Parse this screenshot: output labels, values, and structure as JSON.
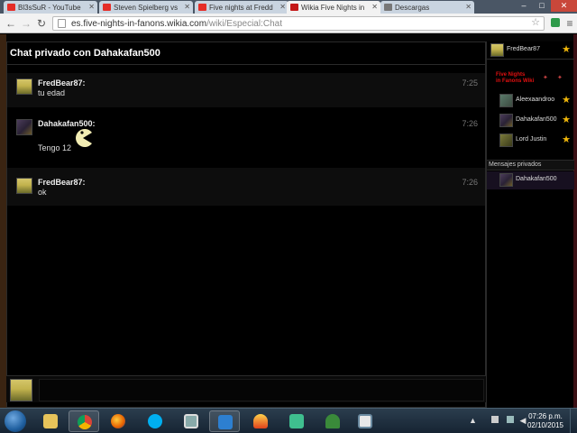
{
  "tabs": [
    {
      "label": "Bl3sSuR - YouTube",
      "favicon_color": "#e52d27"
    },
    {
      "label": "Steven Spielberg vs",
      "favicon_color": "#e52d27"
    },
    {
      "label": "Five nights at Fredd",
      "favicon_color": "#e52d27"
    },
    {
      "label": "Wikia Five Nights in",
      "favicon_color": "#c41818"
    },
    {
      "label": "Descargas",
      "favicon_color": "#777777"
    }
  ],
  "window_controls": {
    "minimize": "–",
    "maximize": "□",
    "close": "✕"
  },
  "toolbar": {
    "url_host": "es.five-nights-in-fanons.wikia.com",
    "url_path": "/wiki/Especial:Chat"
  },
  "chat": {
    "header": "Chat privado con Dahakafan500",
    "messages": [
      {
        "author": "FredBear87:",
        "text": "tu edad",
        "time": "7:25"
      },
      {
        "author": "Dahakafan500:",
        "text": "Tengo 12",
        "time": "7:26"
      },
      {
        "author": "FredBear87:",
        "text": "ok",
        "time": "7:26"
      }
    ]
  },
  "sidebar": {
    "me": "FredBear87",
    "wiki_logo_line1": "Five Nights",
    "wiki_logo_line2": "in Fanons Wiki",
    "users": [
      "Aleexaandroo",
      "Dahakafan500",
      "Lord Justin"
    ],
    "private_header": "Mensajes privados",
    "private_users": [
      "Dahakafan500"
    ]
  },
  "taskbar": {
    "tray_arrow": "▲",
    "time": "07:26 p.m.",
    "date": "02/10/2015"
  },
  "accent": {
    "star": "#f0b70a",
    "wiki_red": "#e01010"
  }
}
